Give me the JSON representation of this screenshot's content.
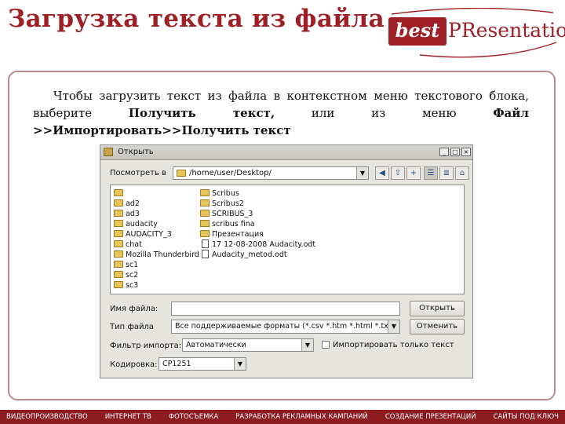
{
  "slide": {
    "title": "Загрузка текста из файла",
    "logo": {
      "badge": "best",
      "text": "PResentation"
    },
    "paragraph": {
      "lead": "Чтобы загрузить текст из файла в контекстном меню текстового блока, выберите",
      "cmd1": "Получить текст,",
      "mid": "или из меню",
      "cmd2": "Файл >>Импортировать>>Получить текст"
    }
  },
  "dialog": {
    "title": "Открыть",
    "look_in_label": "Посмотреть в",
    "path": "/home/user/Desktop/",
    "files_col1": [
      {
        "name": "",
        "type": "folder"
      },
      {
        "name": "ad2",
        "type": "folder"
      },
      {
        "name": "ad3",
        "type": "folder"
      },
      {
        "name": "audacity",
        "type": "folder"
      },
      {
        "name": "AUDACITY_3",
        "type": "folder"
      },
      {
        "name": "chat",
        "type": "folder"
      },
      {
        "name": "Mozilla Thunderbird",
        "type": "folder"
      },
      {
        "name": "sc1",
        "type": "folder"
      },
      {
        "name": "sc2",
        "type": "folder"
      },
      {
        "name": "sc3",
        "type": "folder"
      }
    ],
    "files_col2": [
      {
        "name": "Scribus",
        "type": "folder"
      },
      {
        "name": "Scribus2",
        "type": "folder"
      },
      {
        "name": "SCRIBUS_3",
        "type": "folder"
      },
      {
        "name": "scribus fina",
        "type": "folder"
      },
      {
        "name": "Презентация",
        "type": "folder"
      },
      {
        "name": "17 12-08-2008 Audacity.odt",
        "type": "doc"
      },
      {
        "name": "Audacity_metod.odt",
        "type": "doc"
      }
    ],
    "filename_label": "Имя файла:",
    "filename_value": "",
    "filetype_label": "Тип файла",
    "filetype_value": "Все поддерживаемые форматы (*.csv *.htm *.html *.txt",
    "import_filter_label": "Фильтр импорта:",
    "import_filter_value": "Автоматически",
    "import_text_only_label": "Импортировать только текст",
    "encoding_label": "Кодировка:",
    "encoding_value": "CP1251",
    "open_button": "Открыть",
    "cancel_button": "Отменить"
  },
  "footer": {
    "items": [
      "ВИДЕОПРОИЗВОДСТВО",
      "ИНТЕРНЕТ ТВ",
      "ФОТОСЪЕМКА",
      "РАЗРАБОТКА РЕКЛАМНЫХ КАМПАНИЙ",
      "СОЗДАНИЕ ПРЕЗЕНТАЦИЙ",
      "САЙТЫ ПОД КЛЮЧ"
    ]
  },
  "colors": {
    "brand": "#9e1f25",
    "footer_bg": "#8d1b20",
    "dialog_bg": "#e6e4df"
  }
}
